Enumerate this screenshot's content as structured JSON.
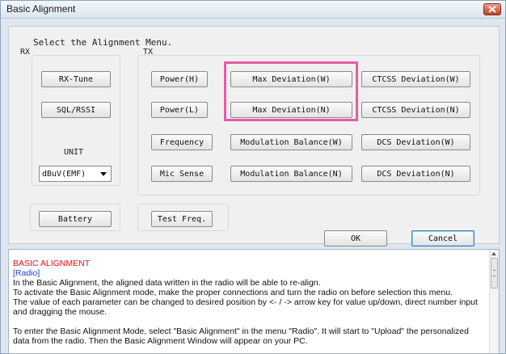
{
  "window": {
    "title": "Basic Alignment",
    "close_icon": "close-icon",
    "close_color": "#c2402a"
  },
  "menu": {
    "heading": "Select the Alignment Menu."
  },
  "rx": {
    "label": "RX",
    "buttons": [
      "RX-Tune",
      "SQL/RSSI"
    ],
    "unit_label": "UNIT",
    "unit_value": "dBuV(EMF)"
  },
  "tx": {
    "label": "TX",
    "col1": [
      "Power(H)",
      "Power(L)",
      "Frequency",
      "Mic Sense"
    ],
    "col2": [
      "Max Deviation(W)",
      "Max Deviation(N)",
      "Modulation Balance(W)",
      "Modulation Balance(N)"
    ],
    "col3": [
      "CTCSS Deviation(W)",
      "CTCSS Deviation(N)",
      "DCS Deviation(W)",
      "DCS Deviation(N)"
    ]
  },
  "bottom": {
    "battery": "Battery",
    "test_freq": "Test Freq.",
    "ok": "OK",
    "cancel": "Cancel"
  },
  "highlight_color": "#e85aa8",
  "help": {
    "title": "BASIC ALIGNMENT",
    "subtitle": "[Radio]",
    "lines": [
      "In the Basic Alignment, the aligned data written in the radio will be able to re-align.",
      "To activate the Basic Alignment mode, make the proper connections and turn the radio on before selection this menu.",
      "The value of each parameter can be changed to desired position by <- / -> arrow key for value up/down, direct number input",
      "and dragging the mouse.",
      "",
      "To enter the Basic Alignment Mode, select \"Basic Alignment\" in the menu \"Radio\". It will start to \"Upload\" the personalized",
      "data from the radio. Then the Basic Alignment Window will appear on your PC."
    ],
    "title_color": "#e01010",
    "subtitle_color": "#1f3fd0"
  }
}
